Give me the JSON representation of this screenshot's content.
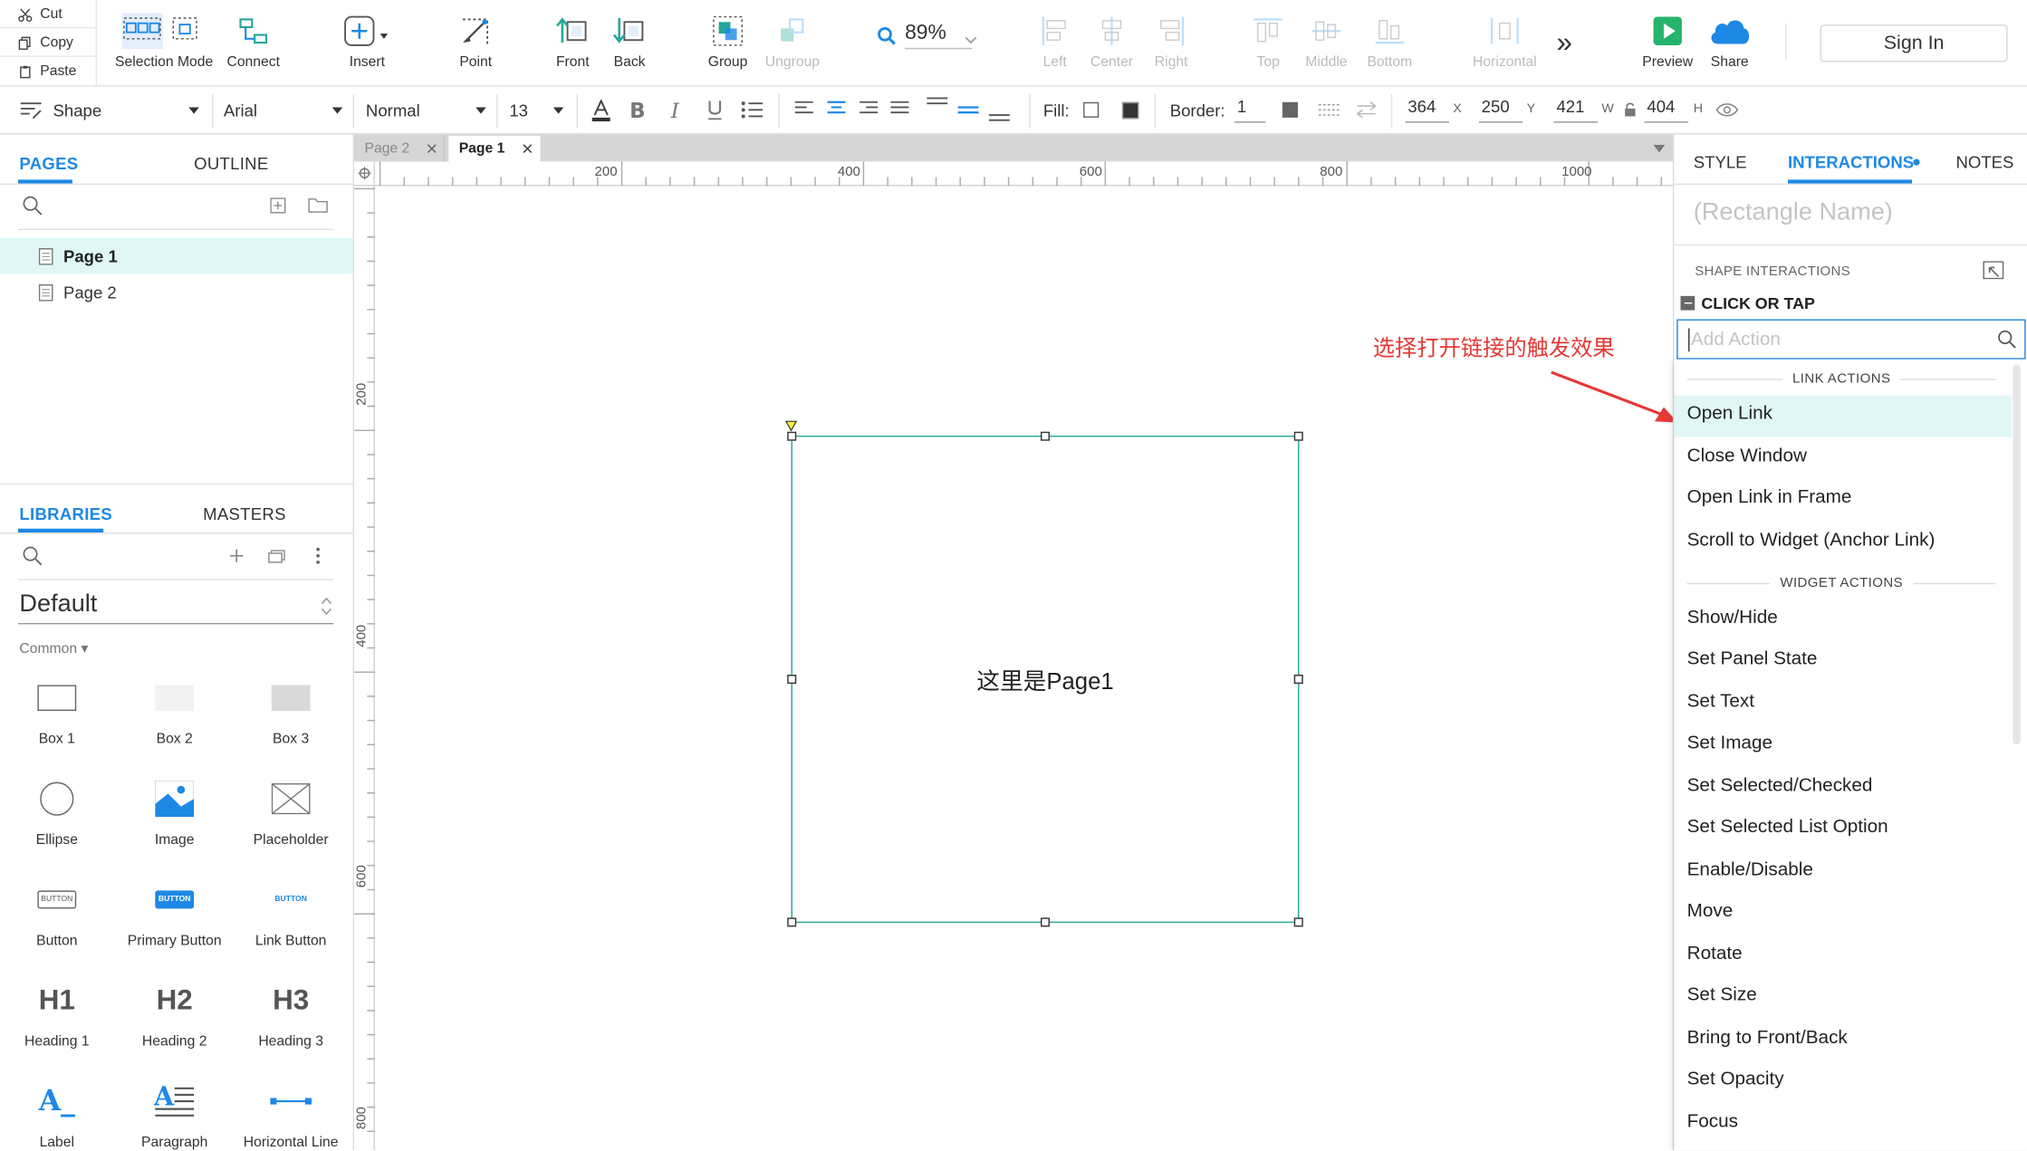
{
  "clipboard": {
    "cut": "Cut",
    "copy": "Copy",
    "paste": "Paste"
  },
  "toolbar": {
    "selection_mode": "Selection Mode",
    "connect": "Connect",
    "insert": "Insert",
    "point": "Point",
    "front": "Front",
    "back": "Back",
    "group": "Group",
    "ungroup": "Ungroup",
    "zoom": "89%",
    "left": "Left",
    "center": "Center",
    "right": "Right",
    "top": "Top",
    "middle": "Middle",
    "bottom": "Bottom",
    "horizontal": "Horizontal",
    "more": "»",
    "preview": "Preview",
    "share": "Share",
    "sign_in": "Sign In"
  },
  "format": {
    "shape": "Shape",
    "font": "Arial",
    "style": "Normal",
    "size": "13",
    "fill_label": "Fill:",
    "border_label": "Border:",
    "border_value": "1",
    "x": "364",
    "x_label": "X",
    "y": "250",
    "y_label": "Y",
    "w": "421",
    "w_label": "W",
    "h": "404",
    "h_label": "H"
  },
  "left": {
    "pages_tab": "PAGES",
    "outline_tab": "OUTLINE",
    "pages": [
      {
        "label": "Page 1"
      },
      {
        "label": "Page 2"
      }
    ],
    "libraries_tab": "LIBRARIES",
    "masters_tab": "MASTERS",
    "library_name": "Default",
    "category": "Common ▾",
    "widgets": [
      {
        "label": "Box 1"
      },
      {
        "label": "Box 2"
      },
      {
        "label": "Box 3"
      },
      {
        "label": "Ellipse"
      },
      {
        "label": "Image"
      },
      {
        "label": "Placeholder"
      },
      {
        "label": "Button"
      },
      {
        "label": "Primary Button"
      },
      {
        "label": "Link Button"
      },
      {
        "label": "Heading 1"
      },
      {
        "label": "Heading 2"
      },
      {
        "label": "Heading 3"
      },
      {
        "label": "Label"
      },
      {
        "label": "Paragraph"
      },
      {
        "label": "Horizontal Line"
      }
    ],
    "button_glyph": "BUTTON",
    "h1_glyph": "H1",
    "h2_glyph": "H2",
    "h3_glyph": "H3",
    "label_glyph": "A_"
  },
  "canvas": {
    "tabs": [
      {
        "label": "Page 2"
      },
      {
        "label": "Page 1"
      }
    ],
    "ruler_h": [
      "200",
      "400",
      "600",
      "800",
      "1000"
    ],
    "ruler_v": [
      "200",
      "400",
      "600",
      "800"
    ],
    "shape_text": "这里是Page1"
  },
  "right": {
    "style_tab": "STYLE",
    "interactions_tab": "INTERACTIONS",
    "notes_tab": "NOTES",
    "name_placeholder": "(Rectangle Name)",
    "shape_interactions": "SHAPE INTERACTIONS",
    "event": "CLICK OR TAP",
    "add_action_placeholder": "Add Action",
    "link_actions_header": "LINK ACTIONS",
    "link_actions": [
      {
        "label": "Open Link"
      },
      {
        "label": "Close Window"
      },
      {
        "label": "Open Link in Frame"
      },
      {
        "label": "Scroll to Widget (Anchor Link)"
      }
    ],
    "widget_actions_header": "WIDGET ACTIONS",
    "widget_actions": [
      {
        "label": "Show/Hide"
      },
      {
        "label": "Set Panel State"
      },
      {
        "label": "Set Text"
      },
      {
        "label": "Set Image"
      },
      {
        "label": "Set Selected/Checked"
      },
      {
        "label": "Set Selected List Option"
      },
      {
        "label": "Enable/Disable"
      },
      {
        "label": "Move"
      },
      {
        "label": "Rotate"
      },
      {
        "label": "Set Size"
      },
      {
        "label": "Bring to Front/Back"
      },
      {
        "label": "Set Opacity"
      },
      {
        "label": "Focus"
      }
    ]
  },
  "annotation": {
    "text": "选择打开链接的触发效果"
  },
  "colors": {
    "accent": "#1e88e5",
    "selection": "#26a69a",
    "annotation": "#e53935"
  }
}
